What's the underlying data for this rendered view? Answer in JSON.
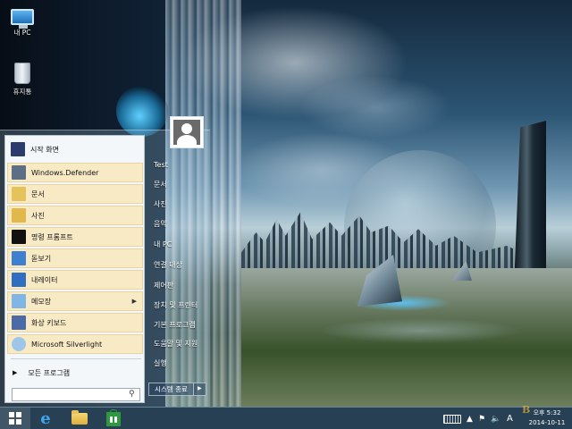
{
  "desktop": {
    "icons": [
      {
        "label": "내 PC",
        "icon": "this-pc-icon"
      },
      {
        "label": "휴지통",
        "icon": "recycle-bin-icon"
      }
    ]
  },
  "start_menu": {
    "items": [
      {
        "label": "시작 화면",
        "icon": "start-screen-icon",
        "color": "#2b3c6c"
      },
      {
        "label": "Windows.Defender",
        "icon": "defender-icon",
        "color": "#5d6f86"
      },
      {
        "label": "문서",
        "icon": "documents-icon",
        "color": "#e5c25a"
      },
      {
        "label": "사진",
        "icon": "pictures-icon",
        "color": "#e2b84a"
      },
      {
        "label": "명령 프롬프트",
        "icon": "command-prompt-icon",
        "color": "#111111"
      },
      {
        "label": "돋보기",
        "icon": "magnifier-icon",
        "color": "#3e7fcf"
      },
      {
        "label": "내레이터",
        "icon": "narrator-icon",
        "color": "#2f6ec0"
      },
      {
        "label": "메모장",
        "icon": "notepad-icon",
        "color": "#7fb6e6",
        "submenu": true
      },
      {
        "label": "화상 키보드",
        "icon": "onscreen-keyboard-icon",
        "color": "#4b6aa8"
      },
      {
        "label": "Microsoft Silverlight",
        "icon": "silverlight-icon",
        "color": "#9ec6e8"
      }
    ],
    "all_programs": "모든 프로그램",
    "search": {
      "placeholder": ""
    },
    "right_pane": {
      "items": [
        "Test",
        "문서",
        "사진",
        "음악",
        "내 PC",
        "연결 대상",
        "제어판",
        "장치 및 프린터",
        "기본 프로그램",
        "도움말 및 지원",
        "실행"
      ]
    },
    "shutdown_label": "시스템 종료"
  },
  "taskbar": {
    "pinned": [
      {
        "name": "internet-explorer",
        "icon": "internet-explorer-icon",
        "glyph": "e"
      },
      {
        "name": "file-explorer",
        "icon": "folder-icon"
      },
      {
        "name": "store",
        "icon": "store-icon"
      }
    ],
    "tray": {
      "language": "A"
    },
    "clock": {
      "time": "오후 5:32",
      "date": "2014-10-11"
    }
  },
  "watermark": "B"
}
